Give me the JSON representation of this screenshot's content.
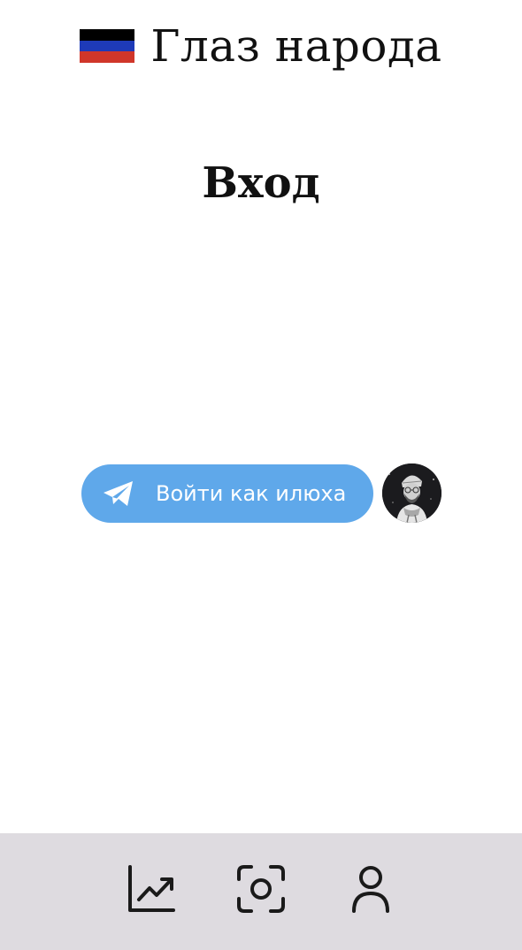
{
  "header": {
    "app_title": "Глаз народа",
    "flag_icon": "dpr-flag-icon",
    "flag_colors": [
      "#000000",
      "#1e3ab8",
      "#d0362a"
    ]
  },
  "page": {
    "title": "Вход"
  },
  "telegram_login": {
    "button_label": "Войти как илюха",
    "icon": "telegram-paper-plane-icon",
    "button_color": "#5fa8ea",
    "avatar": "user-avatar"
  },
  "bottom_nav": {
    "background": "#dedbe0",
    "items": [
      {
        "icon": "chart-trend-icon"
      },
      {
        "icon": "camera-scan-icon"
      },
      {
        "icon": "profile-icon"
      }
    ]
  }
}
